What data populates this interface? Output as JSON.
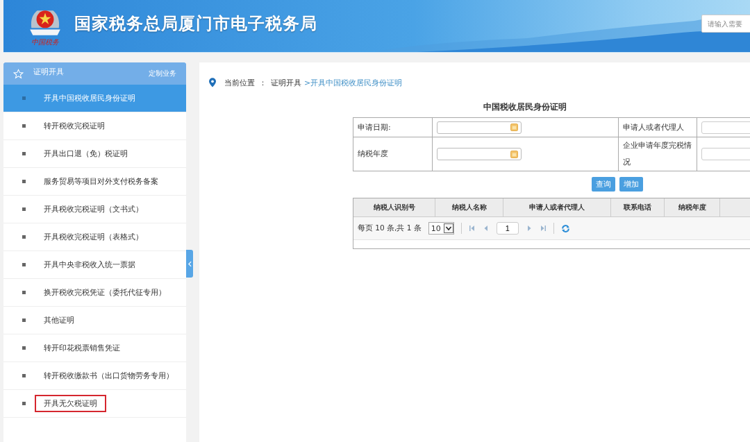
{
  "header": {
    "logo_caption": "中国税务",
    "title": "国家税务总局厦门市电子税务局",
    "search": {
      "placeholder": "请输入需要"
    }
  },
  "sidebar": {
    "title": "证明开具",
    "link": "定制业务",
    "items": [
      {
        "label": "开具中国税收居民身份证明",
        "selected": true,
        "highlighted": false
      },
      {
        "label": "转开税收完税证明",
        "selected": false,
        "highlighted": false
      },
      {
        "label": "开具出口退（免）税证明",
        "selected": false,
        "highlighted": false
      },
      {
        "label": "服务贸易等项目对外支付税务备案",
        "selected": false,
        "highlighted": false
      },
      {
        "label": "开具税收完税证明（文书式）",
        "selected": false,
        "highlighted": false
      },
      {
        "label": "开具税收完税证明（表格式）",
        "selected": false,
        "highlighted": false
      },
      {
        "label": "开具中央非税收入统一票据",
        "selected": false,
        "highlighted": false
      },
      {
        "label": "换开税收完税凭证（委托代征专用）",
        "selected": false,
        "highlighted": false
      },
      {
        "label": "其他证明",
        "selected": false,
        "highlighted": false
      },
      {
        "label": "转开印花税票销售凭证",
        "selected": false,
        "highlighted": false
      },
      {
        "label": "转开税收缴款书（出口货物劳务专用）",
        "selected": false,
        "highlighted": false
      },
      {
        "label": "开具无欠税证明",
        "selected": false,
        "highlighted": true
      }
    ]
  },
  "breadcrumb": {
    "label": "当前位置",
    "separator": "：",
    "parent": "证明开具",
    "current": ">开具中国税收居民身份证明"
  },
  "form": {
    "title": "中国税收居民身份证明",
    "rows": [
      {
        "fields": [
          {
            "label": "申请日期:",
            "kind": "date"
          },
          {
            "label": "申请人或者代理人",
            "kind": "text"
          }
        ]
      },
      {
        "fields": [
          {
            "label": "纳税年度",
            "kind": "date"
          },
          {
            "label": "企业申请年度完税情况",
            "kind": "text"
          }
        ]
      }
    ],
    "buttons": [
      "查询",
      "增加"
    ]
  },
  "grid": {
    "columns": [
      "纳税人识别号",
      "纳税人名称",
      "申请人或者代理人",
      "联系电话",
      "纳税年度"
    ],
    "pager": {
      "summary": "每页 10 条,共 1 条",
      "page_size": "10",
      "page": "1"
    }
  }
}
